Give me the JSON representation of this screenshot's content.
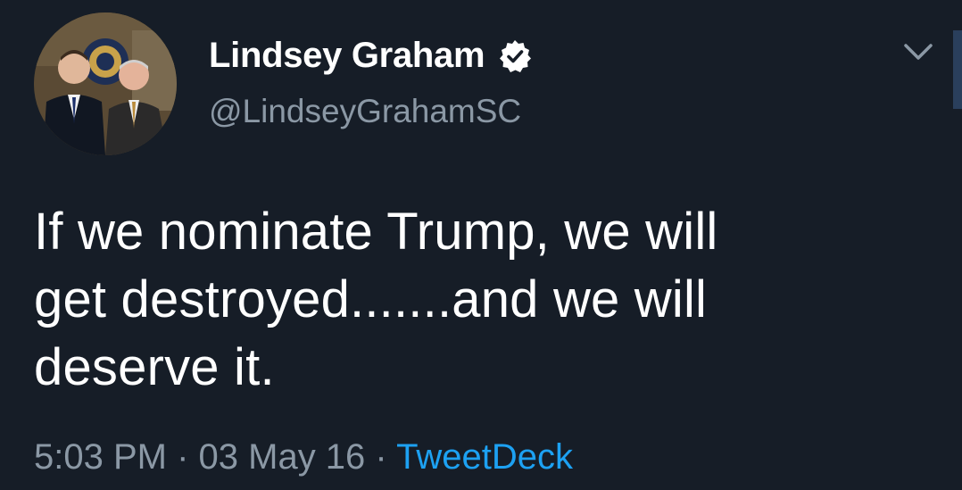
{
  "colors": {
    "background": "#161d27",
    "primary_text": "#ffffff",
    "secondary_text": "#8b98a5",
    "link": "#1da1f2"
  },
  "author": {
    "name": "Lindsey Graham",
    "handle": "@LindseyGrahamSC",
    "verified": true,
    "avatar_icon": "profile-photo"
  },
  "tweet": {
    "lines": [
      "If we nominate Trump, we will",
      "get destroyed.......and we will",
      "deserve it."
    ]
  },
  "meta": {
    "time": "5:03 PM",
    "separator": " · ",
    "date": "03 May 16",
    "source": "TweetDeck"
  },
  "controls": {
    "menu_icon": "chevron-down-icon"
  }
}
